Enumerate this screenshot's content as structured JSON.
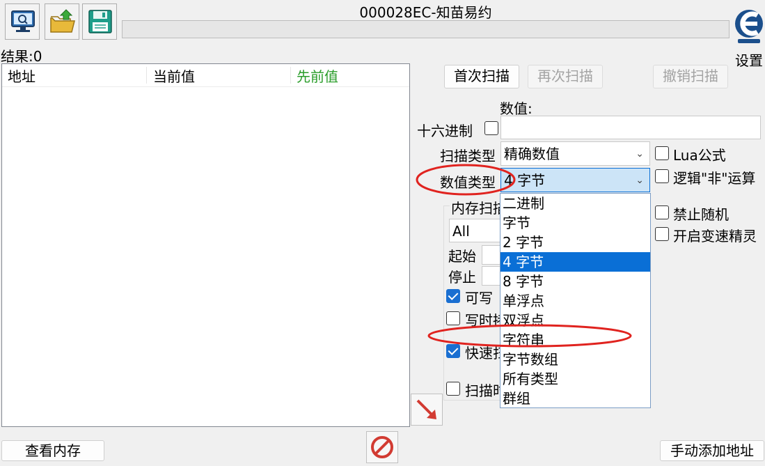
{
  "window": {
    "title": "000028EC-知苗易约"
  },
  "toolbar": {
    "settings_label": "设置"
  },
  "results": {
    "label": "结果:0"
  },
  "table": {
    "columns": [
      "地址",
      "当前值",
      "先前值"
    ]
  },
  "scan_buttons": {
    "first_scan": "首次扫描",
    "next_scan": "再次扫描",
    "undo_scan": "撤销扫描"
  },
  "value": {
    "label": "数值:",
    "input": ""
  },
  "hex": {
    "label": "十六进制",
    "checked": false
  },
  "scan_type": {
    "label": "扫描类型",
    "selected": "精确数值"
  },
  "value_type": {
    "label": "数值类型",
    "selected": "4 字节",
    "options": [
      "二进制",
      "字节",
      "2 字节",
      "4 字节",
      "8 字节",
      "单浮点",
      "双浮点",
      "字符串",
      "字节数组",
      "所有类型",
      "群组"
    ],
    "selected_index": 3
  },
  "right_options": {
    "lua_formula": "Lua公式",
    "logical_not": "逻辑\"非\"运算",
    "disable_random": "禁止随机",
    "speedhack": "开启变速精灵"
  },
  "memory_scan": {
    "group_label": "内存扫描",
    "region_value": "All",
    "start_label": "起始",
    "stop_label": "停止",
    "writable": "可写",
    "copy_on_write": "写时拷贝",
    "fast_scan": "快速扫描",
    "pause_scan": "扫描时暂停"
  },
  "bottom": {
    "view_memory": "查看内存",
    "add_address": "手动添加地址"
  },
  "colors": {
    "accent": "#0a6fd6",
    "previous_value_header": "#2a9d2a",
    "annotation_red": "#e0231f"
  }
}
